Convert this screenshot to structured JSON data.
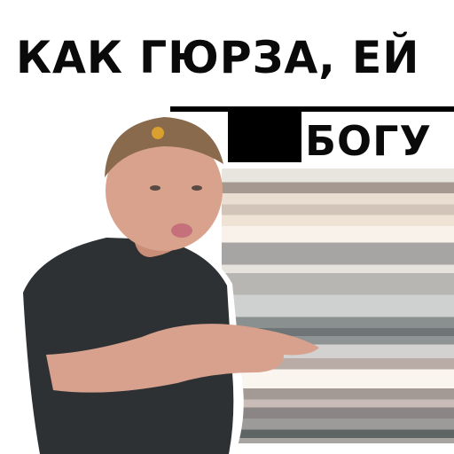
{
  "caption": {
    "line1": "КАК ГЮРЗА, ЕЙ",
    "line2": "БОГУ"
  },
  "colors": {
    "text": "#0a0a0a",
    "background": "#ffffff",
    "shirt": "#2e3133",
    "skin": "#d49a86",
    "bandana": "#8a6a4c"
  }
}
